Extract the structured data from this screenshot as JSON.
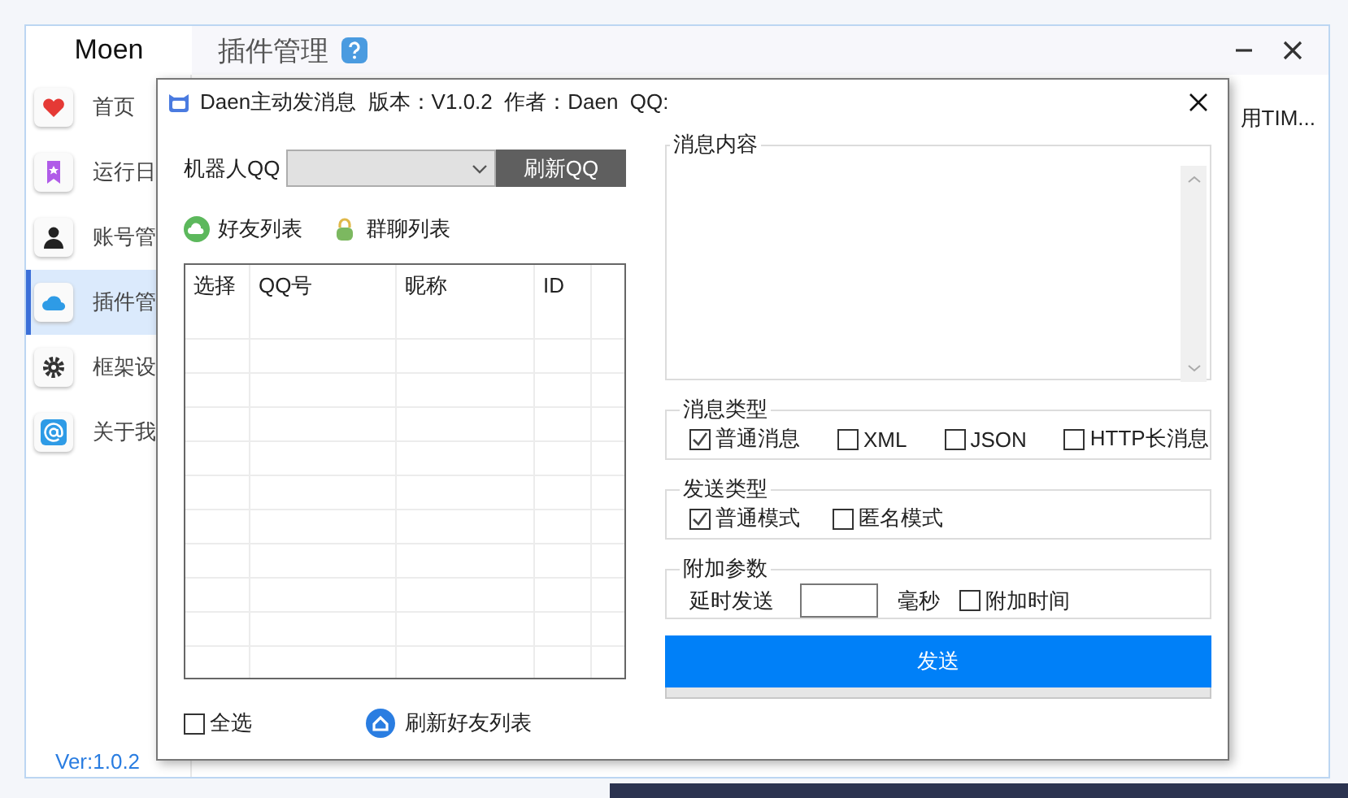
{
  "app": {
    "name": "Moen",
    "page_title": "插件管理",
    "background_text": "用TIM...",
    "version": "Ver:1.0.2"
  },
  "sidebar": {
    "items": [
      {
        "label": "首页",
        "kind": "heart",
        "selected": false
      },
      {
        "label": "运行日",
        "kind": "bookmark",
        "selected": false
      },
      {
        "label": "账号管",
        "kind": "user",
        "selected": false
      },
      {
        "label": "插件管",
        "kind": "cloud",
        "selected": true
      },
      {
        "label": "框架设",
        "kind": "gear",
        "selected": false
      },
      {
        "label": "关于我",
        "kind": "at",
        "selected": false
      }
    ]
  },
  "dialog": {
    "title": "Daen主动发消息  版本：V1.0.2  作者：Daen  QQ:",
    "robot_qq": {
      "label": "机器人QQ",
      "refresh_button": "刷新QQ"
    },
    "list_tabs": [
      {
        "label": "好友列表",
        "kind": "friends"
      },
      {
        "label": "群聊列表",
        "kind": "groups"
      }
    ],
    "table": {
      "columns": [
        "选择",
        "QQ号",
        "昵称",
        "ID"
      ]
    },
    "select_all": {
      "label": "全选",
      "checked": false
    },
    "refresh_friends": "刷新好友列表",
    "message_content": {
      "title": "消息内容"
    },
    "message_type": {
      "title": "消息类型",
      "options": [
        {
          "label": "普通消息",
          "checked": true
        },
        {
          "label": "XML",
          "checked": false
        },
        {
          "label": "JSON",
          "checked": false
        },
        {
          "label": "HTTP长消息",
          "checked": false
        }
      ]
    },
    "send_type": {
      "title": "发送类型",
      "options": [
        {
          "label": "普通模式",
          "checked": true
        },
        {
          "label": "匿名模式",
          "checked": false
        }
      ]
    },
    "extra_params": {
      "title": "附加参数",
      "delay_label": "延时发送",
      "unit": "毫秒",
      "attach_time": {
        "label": "附加时间",
        "checked": false
      }
    },
    "send_button": "发送",
    "progress": {
      "level": 0
    }
  }
}
